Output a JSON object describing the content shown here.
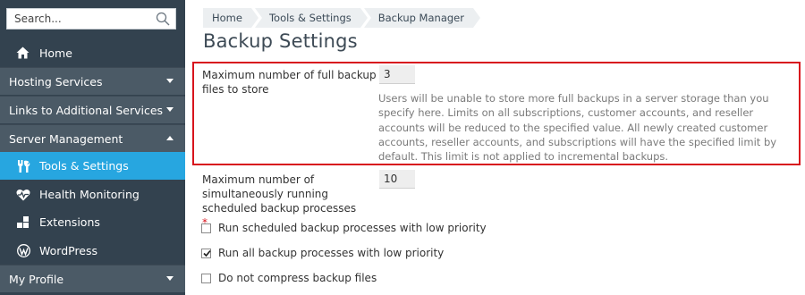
{
  "sidebar": {
    "search": {
      "placeholder": "Search..."
    },
    "home_label": "Home",
    "groups": [
      {
        "label": "Hosting Services",
        "expanded": false
      },
      {
        "label": "Links to Additional Services",
        "expanded": false
      },
      {
        "label": "Server Management",
        "expanded": true
      },
      {
        "label": "My Profile",
        "expanded": false
      }
    ],
    "server_items": [
      {
        "label": "Tools & Settings",
        "icon": "tools-icon",
        "active": true
      },
      {
        "label": "Health Monitoring",
        "icon": "heart-monitor-icon",
        "active": false
      },
      {
        "label": "Extensions",
        "icon": "extensions-icon",
        "active": false
      },
      {
        "label": "WordPress",
        "icon": "wordpress-icon",
        "active": false
      }
    ]
  },
  "breadcrumb": [
    "Home",
    "Tools & Settings",
    "Backup Manager"
  ],
  "page_title": "Backup Settings",
  "form": {
    "max_full_backups": {
      "label": "Maximum number of full backup files to store",
      "value": "3",
      "hint": "Users will be unable to store more full backups in a server storage than you specify here. Limits on all subscriptions, customer accounts, and reseller accounts will be reduced to the specified value. All newly created customer accounts, reseller accounts, and subscriptions will have the specified limit by default. This limit is not applied to incremental backups."
    },
    "max_simultaneous": {
      "label": "Maximum number of simultaneously running scheduled backup processes",
      "required_mark": "*",
      "value": "10"
    },
    "checkboxes": [
      {
        "label": "Run scheduled backup processes with low priority",
        "checked": false
      },
      {
        "label": "Run all backup processes with low priority",
        "checked": true
      },
      {
        "label": "Do not compress backup files",
        "checked": false
      }
    ]
  },
  "colors": {
    "sidebar_bg": "#33424f",
    "group_bg": "#4b5a66",
    "active_bg": "#27a6e0",
    "highlight_border": "#d8141d"
  }
}
